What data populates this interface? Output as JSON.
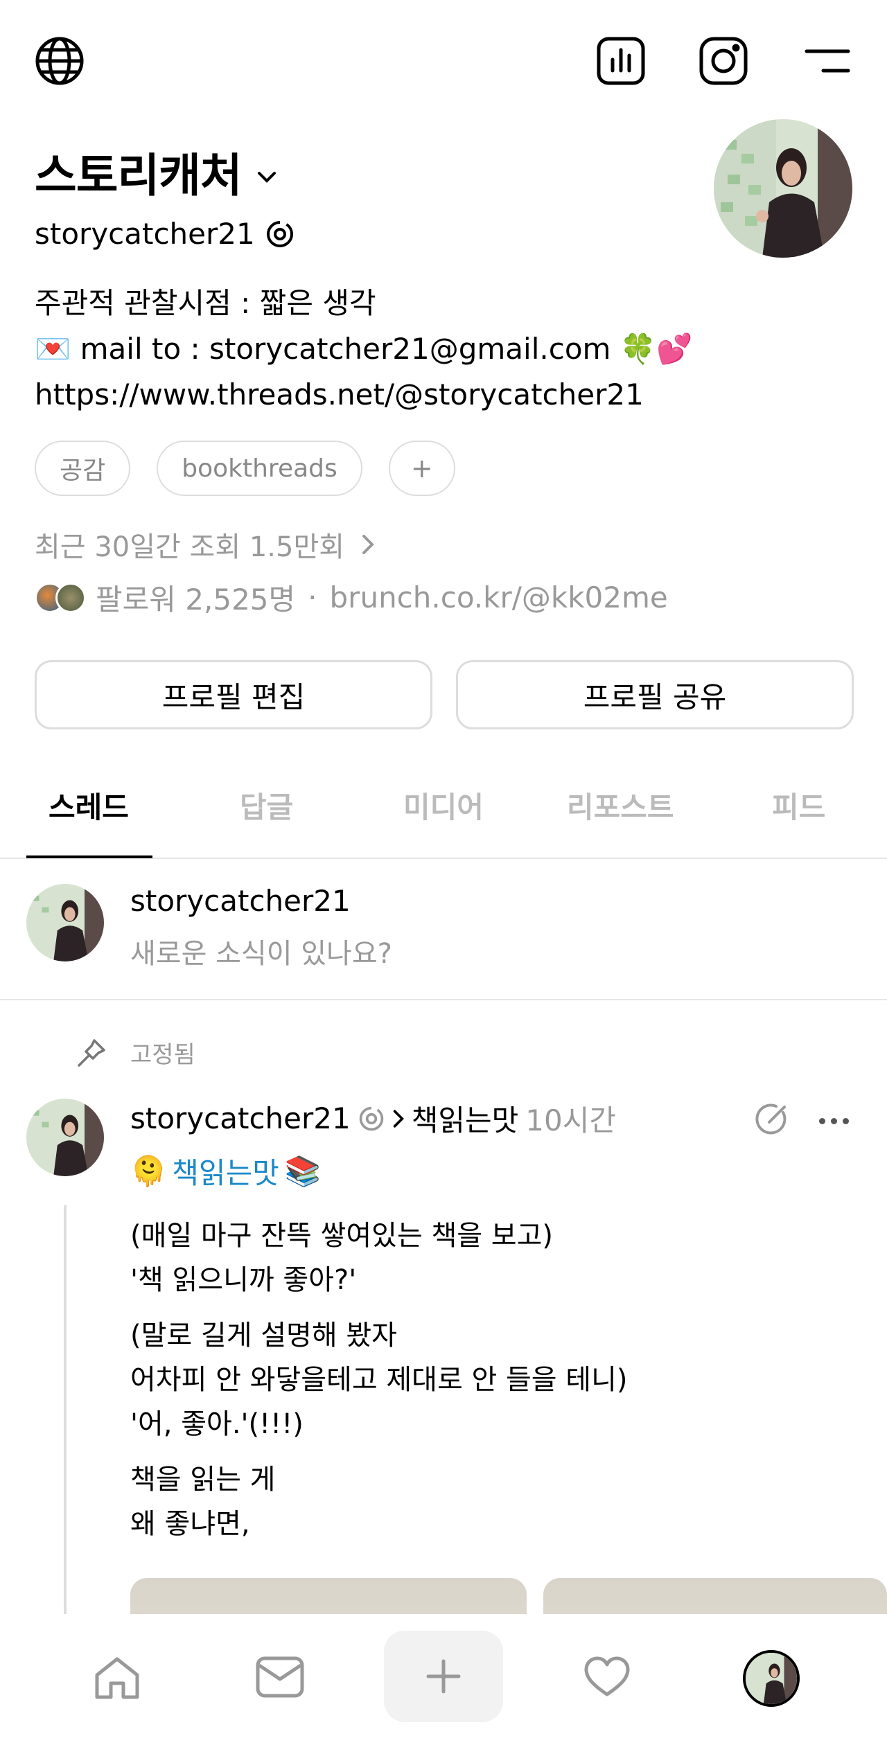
{
  "profile": {
    "display_name": "스토리캐처",
    "handle": "storycatcher21",
    "bio_line1": "주관적 관찰시점 : 짧은 생각",
    "bio_line2": "💌 mail to : storycatcher21@gmail.com 🍀💕",
    "bio_line3": "https://www.threads.net/@storycatcher21",
    "tags": [
      "공감",
      "bookthreads",
      "+"
    ],
    "views": "최근 30일간 조회 1.5만회",
    "followers": "팔로워 2,525명",
    "separator": "·",
    "link": "brunch.co.kr/@kk02me",
    "edit_button": "프로필 편집",
    "share_button": "프로필 공유"
  },
  "tabs": [
    "스레드",
    "답글",
    "미디어",
    "리포스트",
    "피드"
  ],
  "composer": {
    "username": "storycatcher21",
    "placeholder": "새로운 소식이 있나요?"
  },
  "post": {
    "pinned_label": "고정됨",
    "username": "storycatcher21",
    "community": "책읽는맛",
    "time": "10시간",
    "topic": "책읽는맛",
    "topic_emoji_left": "🫠",
    "topic_emoji_right": "📚",
    "lines": [
      [
        "(매일 마구 잔뜩 쌓여있는 책을 보고)",
        "'책 읽으니까 좋아?'"
      ],
      [
        "(말로 길게 설명해 봤자",
        "어차피 안 와닿을테고 제대로 안 들을 테니)",
        "'어, 좋아.'(!!!)"
      ],
      [
        "책을 읽는 게",
        "왜 좋냐면,"
      ]
    ]
  },
  "icons": {
    "globe": "globe-icon",
    "insights": "bar-chart-icon",
    "instagram": "instagram-icon",
    "menu": "menu-icon",
    "verified": "threads-badge-icon"
  }
}
